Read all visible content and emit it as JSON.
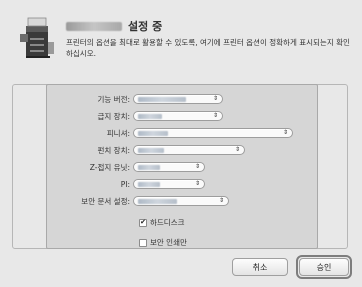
{
  "header": {
    "title": "설정 중",
    "description": "프린터의 옵션을 최대로 활용할 수 있도록, 여기에 프린터 옵션이 정확하게 표시되는지 확인하십시오."
  },
  "options": [
    {
      "label": "기능 버전:"
    },
    {
      "label": "급지 장치:"
    },
    {
      "label": "피니셔:"
    },
    {
      "label": "펀치 장치:"
    },
    {
      "label": "Z-접지 유닛:"
    },
    {
      "label": "PI:"
    },
    {
      "label": "보안 문서 설정:"
    }
  ],
  "checkboxes": [
    {
      "label": "하드디스크",
      "checked": true
    },
    {
      "label": "보안 인쇄만",
      "checked": false
    }
  ],
  "buttons": {
    "cancel": "취소",
    "ok": "승인"
  }
}
